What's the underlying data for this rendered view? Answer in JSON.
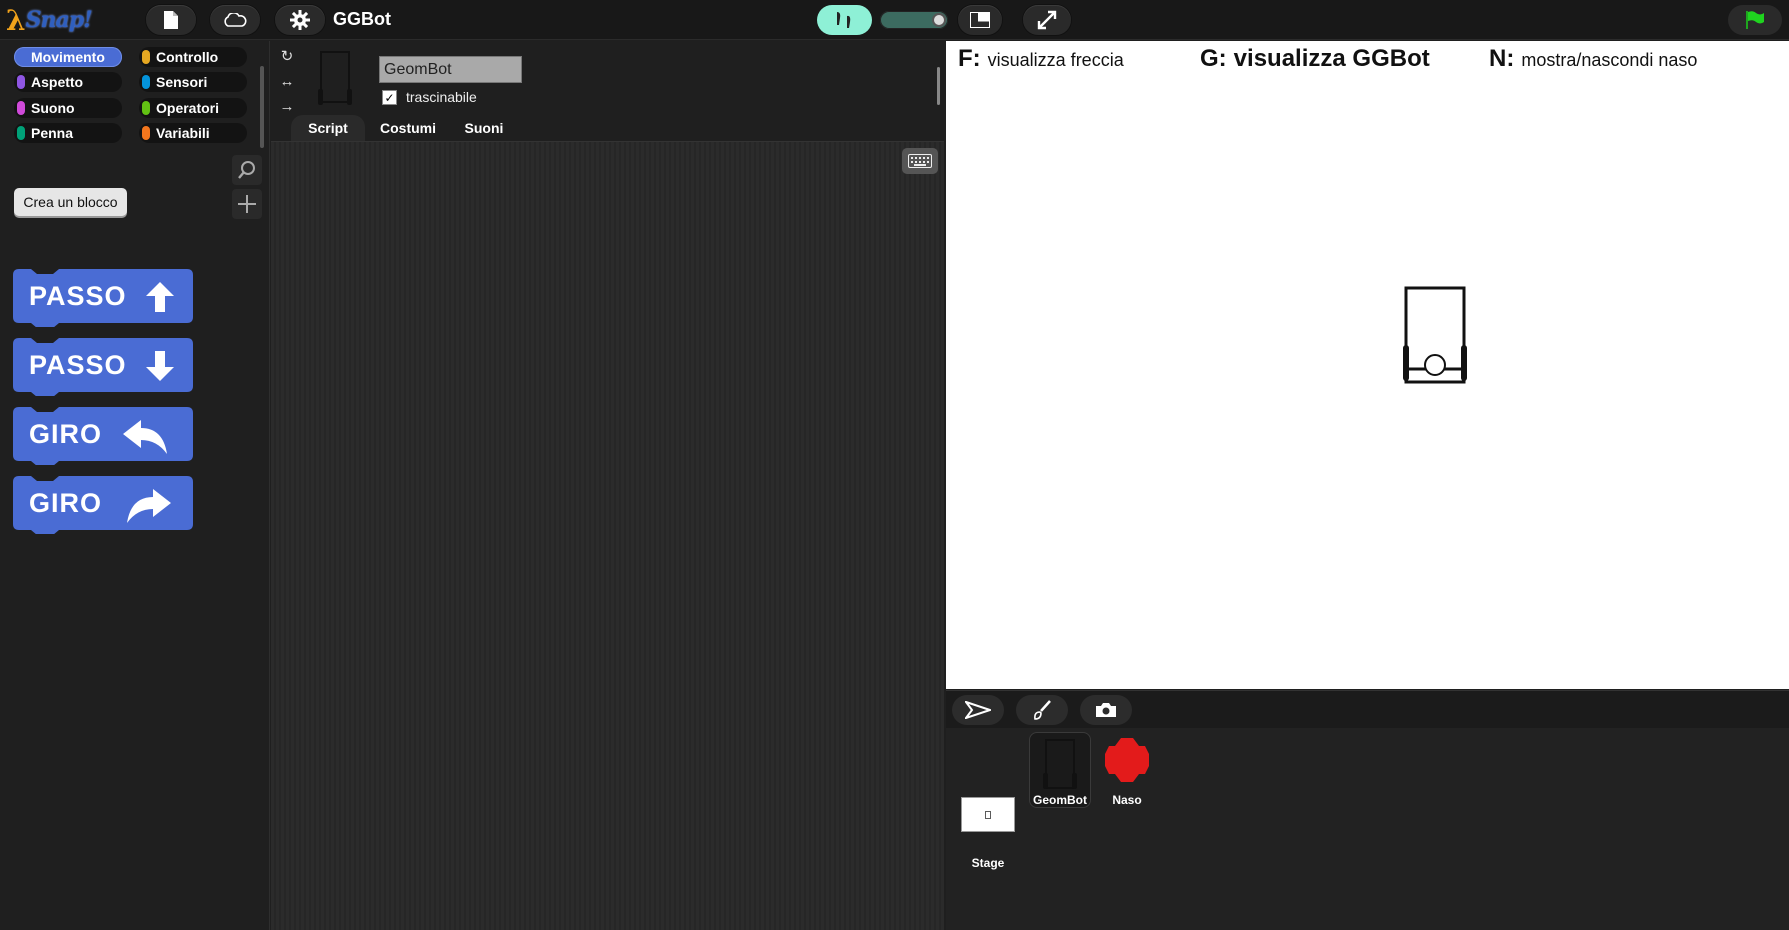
{
  "app": {
    "name": "Snap!",
    "project_title": "GGBot"
  },
  "icons": {
    "new_project": "file-icon",
    "cloud": "cloud-icon",
    "settings": "gear-icon",
    "steps": "footprints-icon",
    "stage_size": "stage-size-icon",
    "fullscreen": "fullscreen-icon",
    "green_flag": "green-flag-icon",
    "search": "magnifier-icon",
    "add": "plus-icon",
    "keyboard": "keyboard-icon"
  },
  "palette": {
    "categories": [
      {
        "label": "Movimento",
        "color": "#4a6cd4",
        "active": true
      },
      {
        "label": "Controllo",
        "color": "#e6a822",
        "active": false
      },
      {
        "label": "Aspetto",
        "color": "#8f56e3",
        "active": false
      },
      {
        "label": "Sensori",
        "color": "#0494dc",
        "active": false
      },
      {
        "label": "Suono",
        "color": "#cf4ad9",
        "active": false
      },
      {
        "label": "Operatori",
        "color": "#62c213",
        "active": false
      },
      {
        "label": "Penna",
        "color": "#00a178",
        "active": false
      },
      {
        "label": "Variabili",
        "color": "#f3761d",
        "active": false
      }
    ],
    "make_block_label": "Crea un blocco",
    "blocks": [
      {
        "label": "PASSO",
        "arrow": "up-arrow-icon"
      },
      {
        "label": "PASSO",
        "arrow": "down-arrow-icon"
      },
      {
        "label": "GIRO",
        "arrow": "turn-left-arrow-icon"
      },
      {
        "label": "GIRO",
        "arrow": "turn-right-arrow-icon"
      }
    ],
    "block_color": "#4a6cd4"
  },
  "sprite": {
    "rotation_styles": [
      "↻",
      "↔",
      "→"
    ],
    "name": "GeomBot",
    "draggable_label": "trascinabile",
    "draggable_checked": "✓",
    "tabs": [
      {
        "label": "Script",
        "active": true
      },
      {
        "label": "Costumi",
        "active": false
      },
      {
        "label": "Suoni",
        "active": false
      }
    ]
  },
  "stage": {
    "hints": [
      {
        "key": "F:",
        "text": "visualizza freccia"
      },
      {
        "key": "G:",
        "text": "visualizza GGBot"
      },
      {
        "key": "N:",
        "text": "mostra/nascondi naso"
      }
    ]
  },
  "corral": {
    "buttons": [
      "turtle-arrow-icon",
      "paintbrush-icon",
      "camera-icon"
    ],
    "sprites": [
      {
        "label": "GeomBot",
        "selected": true
      },
      {
        "label": "Naso",
        "color": "#e31b1b"
      }
    ],
    "stage_label": "Stage"
  }
}
